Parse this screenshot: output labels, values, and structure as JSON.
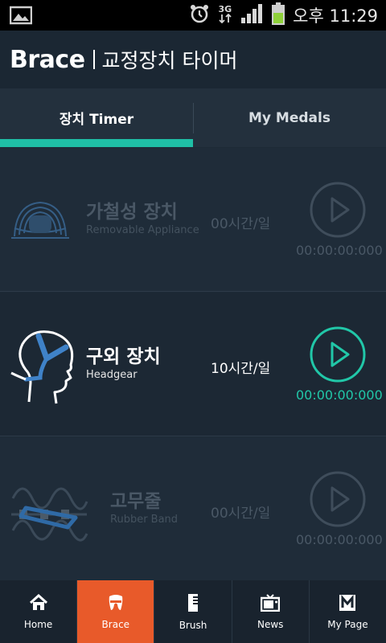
{
  "statusbar": {
    "network": "3G",
    "time": "오후 11:29",
    "icons": [
      "gallery-icon",
      "alarm-icon",
      "signal-icon",
      "battery-icon"
    ]
  },
  "header": {
    "brand": "Brace",
    "subtitle": "교정장치 타이머"
  },
  "tabs": [
    {
      "label": "장치 Timer",
      "active": true
    },
    {
      "label": "My Medals",
      "active": false
    }
  ],
  "devices": [
    {
      "name_ko": "가철성 장치",
      "name_en": "Removable Appliance",
      "hours": "00시간/일",
      "timer": "00:00:00:000",
      "active": false,
      "icon": "removable-appliance-icon"
    },
    {
      "name_ko": "구외 장치",
      "name_en": "Headgear",
      "hours": "10시간/일",
      "timer": "00:00:00:000",
      "active": true,
      "icon": "headgear-icon"
    },
    {
      "name_ko": "고무줄",
      "name_en": "Rubber Band",
      "hours": "00시간/일",
      "timer": "00:00:00:000",
      "active": false,
      "icon": "rubber-band-icon"
    }
  ],
  "nav": [
    {
      "label": "Home",
      "icon": "home-icon",
      "active": false
    },
    {
      "label": "Brace",
      "icon": "brace-icon",
      "active": true
    },
    {
      "label": "Brush",
      "icon": "brush-icon",
      "active": false
    },
    {
      "label": "News",
      "icon": "news-tv-icon",
      "active": false
    },
    {
      "label": "My Page",
      "icon": "my-page-icon",
      "active": false
    }
  ],
  "colors": {
    "accent": "#1fbfa6",
    "nav_active": "#e85a2a",
    "background": "#1d2a36"
  }
}
